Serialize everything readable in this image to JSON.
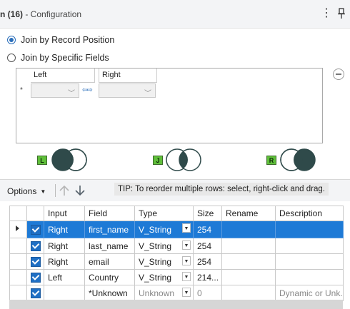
{
  "header": {
    "title_prefix": "n (16)",
    "title_suffix": " - Configuration",
    "menu_icon": "kebab-menu-icon",
    "pin_icon": "pin-icon"
  },
  "join_options": {
    "by_position": "Join by Record Position",
    "by_fields": "Join by Specific Fields",
    "selected": "by_position"
  },
  "join_fields": {
    "left_header": "Left",
    "right_header": "Right",
    "row_marker": "*",
    "left_value": "",
    "right_value": ""
  },
  "anchors": {
    "left": "L",
    "join": "J",
    "right": "R"
  },
  "toolbar": {
    "options_label": "Options",
    "tip": "TIP: To reorder multiple rows: select, right-click and drag."
  },
  "grid": {
    "columns": [
      "Input",
      "Field",
      "Type",
      "Size",
      "Rename",
      "Description"
    ],
    "rows": [
      {
        "input": "Right",
        "field": "first_name",
        "type": "V_String",
        "size": "254",
        "rename": "",
        "description": ""
      },
      {
        "input": "Right",
        "field": "last_name",
        "type": "V_String",
        "size": "254",
        "rename": "",
        "description": ""
      },
      {
        "input": "Right",
        "field": "email",
        "type": "V_String",
        "size": "254",
        "rename": "",
        "description": ""
      },
      {
        "input": "Left",
        "field": "Country",
        "type": "V_String",
        "size": "214...",
        "rename": "",
        "description": ""
      },
      {
        "input": "",
        "field": "*Unknown",
        "type": "Unknown",
        "size": "0",
        "rename": "",
        "description": "Dynamic or Unk..."
      }
    ]
  },
  "colors": {
    "accent": "#1e7ad6",
    "anchor": "#5fbf3a",
    "venn": "#2f4a4a"
  }
}
